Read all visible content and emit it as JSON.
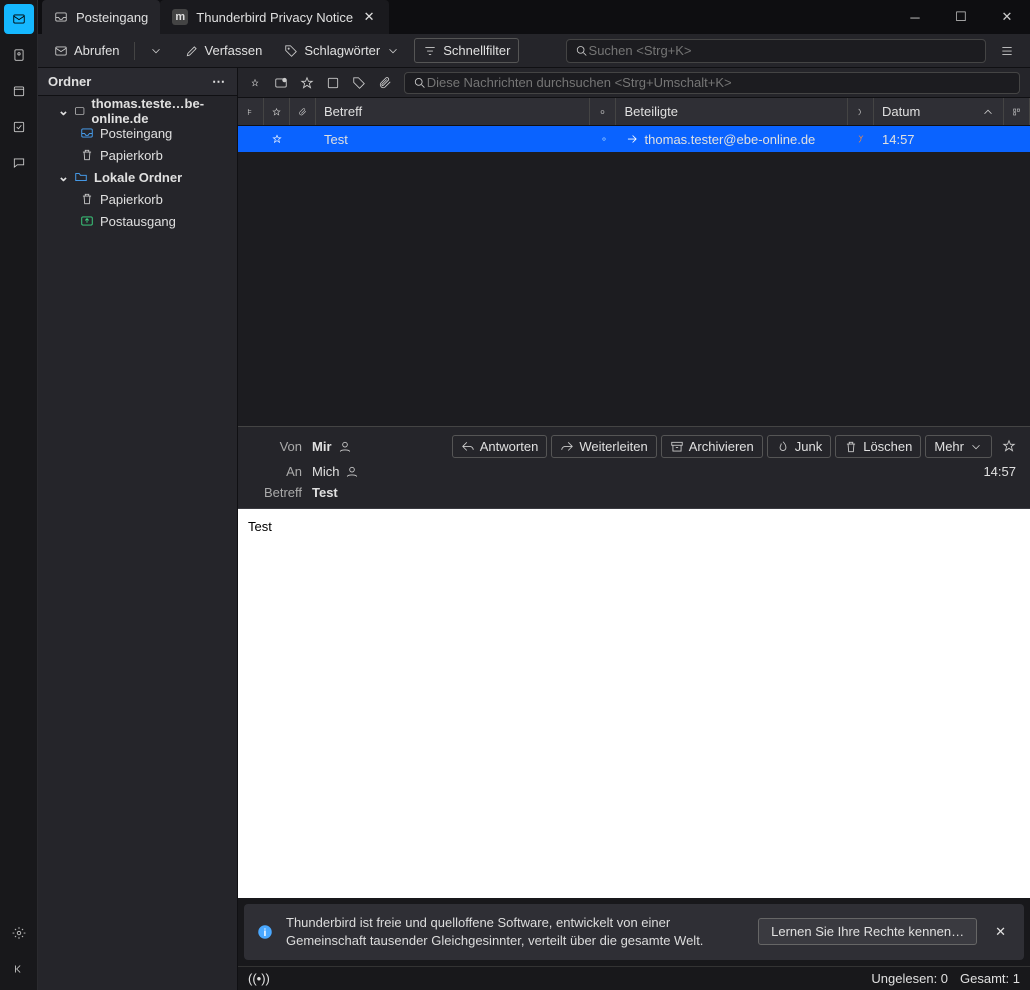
{
  "tabs": {
    "inbox": "Posteingang",
    "privacy": "Thunderbird Privacy Notice"
  },
  "toolbar": {
    "abrufen": "Abrufen",
    "verfassen": "Verfassen",
    "schlagwoerter": "Schlagwörter",
    "schnellfilter": "Schnellfilter",
    "search_placeholder": "Suchen <Strg+K>"
  },
  "folderpane": {
    "title": "Ordner",
    "account": "thomas.teste…be-online.de",
    "inbox": "Posteingang",
    "trash": "Papierkorb",
    "local": "Lokale Ordner",
    "local_trash": "Papierkorb",
    "outbox": "Postausgang"
  },
  "filter_search_placeholder": "Diese Nachrichten durchsuchen <Strg+Umschalt+K>",
  "columns": {
    "subject": "Betreff",
    "participants": "Beteiligte",
    "date": "Datum"
  },
  "message": {
    "subject": "Test",
    "participant": "thomas.tester@ebe-online.de",
    "time": "14:57"
  },
  "reader": {
    "from_label": "Von",
    "from_value": "Mir",
    "to_label": "An",
    "to_value": "Mich",
    "subject_label": "Betreff",
    "subject_value": "Test",
    "time": "14:57",
    "btn_reply": "Antworten",
    "btn_forward": "Weiterleiten",
    "btn_archive": "Archivieren",
    "btn_junk": "Junk",
    "btn_delete": "Löschen",
    "btn_more": "Mehr",
    "body": "Test"
  },
  "notification": {
    "text": "Thunderbird ist freie und quelloffene Software, entwickelt von einer Gemeinschaft tausender Gleichgesinnter, verteilt über die gesamte Welt.",
    "button": "Lernen Sie Ihre Rechte kennen…"
  },
  "statusbar": {
    "unread": "Ungelesen: 0",
    "total": "Gesamt: 1"
  }
}
